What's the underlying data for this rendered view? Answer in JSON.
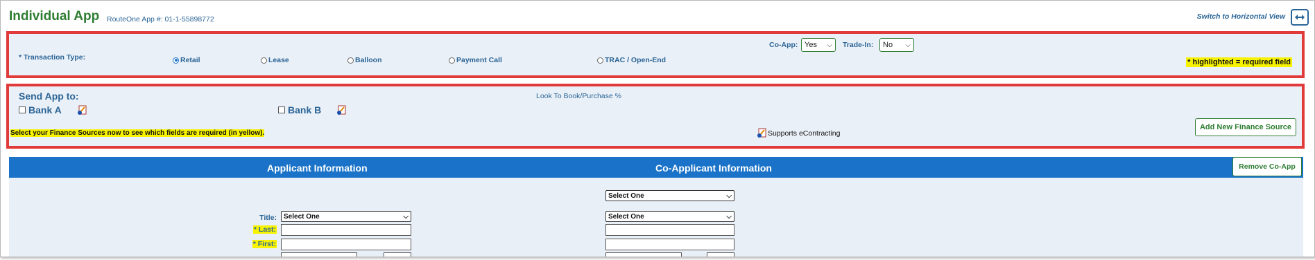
{
  "header": {
    "title": "Individual App",
    "app_number": "RouteOne App #: 01-1-55898772",
    "switch_link": "Switch to Horizontal View"
  },
  "transaction": {
    "label": "* Transaction Type:",
    "options": [
      "Retail",
      "Lease",
      "Balloon",
      "Payment Call",
      "TRAC / Open-End"
    ],
    "selected": "Retail",
    "co_app_label": "Co-App:",
    "co_app_value": "Yes",
    "trade_in_label": "Trade-In:",
    "trade_in_value": "No",
    "required_note": "* highlighted = required field"
  },
  "send_app": {
    "label": "Send App to:",
    "look_to_book": "Look To Book/Purchase %",
    "banks": [
      "Bank A",
      "Bank B"
    ],
    "instruction": "Select your Finance Sources now to see which fields are required (in yellow).",
    "econtract_note": "Supports eContracting",
    "add_button": "Add New Finance Source"
  },
  "applicant_bar": {
    "applicant_title": "Applicant Information",
    "co_applicant_title": "Co-Applicant Information",
    "remove_button": "Remove Co-App"
  },
  "form": {
    "select_placeholder": "Select One",
    "title_label": "Title:",
    "last_label": "* Last:",
    "first_label": "* First:"
  },
  "colors": {
    "brand_green": "#2e7d32",
    "label_blue": "#2a6496",
    "bar_blue": "#1a73c8",
    "highlight_red": "#e03a3a",
    "required_yellow": "#f7f300"
  }
}
